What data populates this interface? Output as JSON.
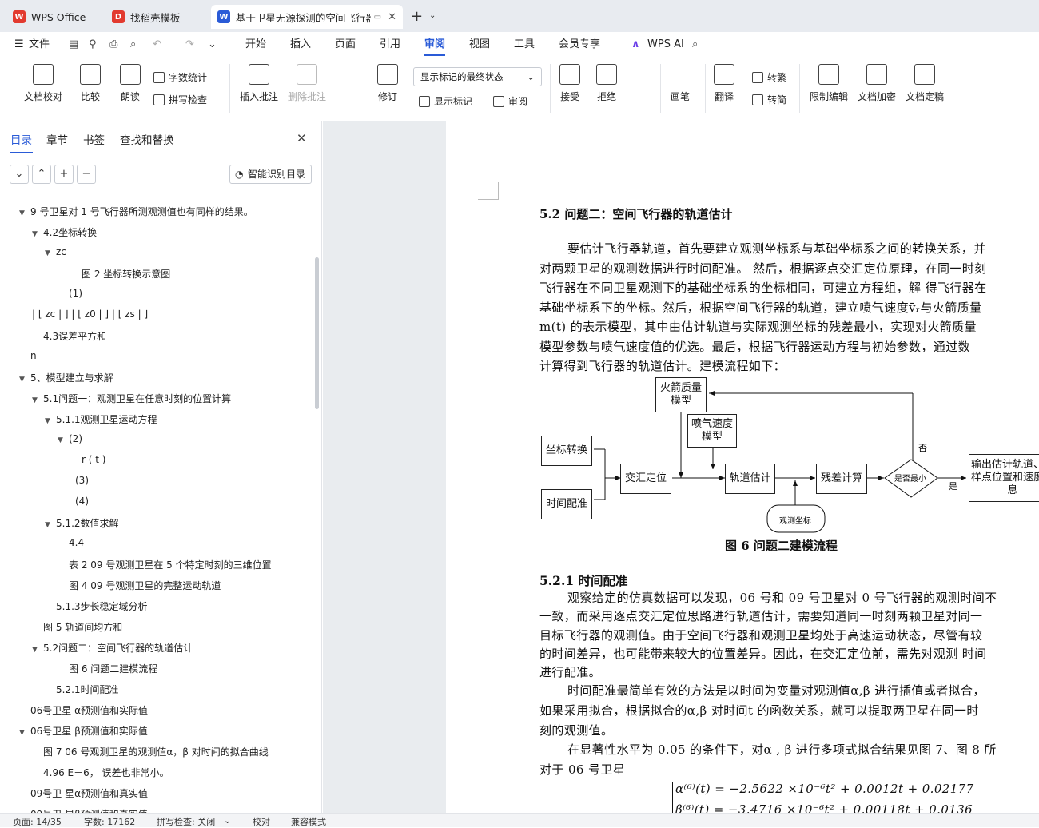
{
  "tabs": [
    {
      "label": "WPS Office",
      "icon": "wps-logo-icon",
      "color": "#e23a2f"
    },
    {
      "label": "找稻壳模板",
      "icon": "docer-icon",
      "color": "#e23a2f"
    },
    {
      "label": "基于卫星无源探测的空间飞行器",
      "icon": "writer-icon",
      "color": "#2a5bd7"
    }
  ],
  "menu": {
    "file": "文件",
    "items": [
      "开始",
      "插入",
      "页面",
      "引用",
      "审阅",
      "视图",
      "工具",
      "会员专享"
    ],
    "active": "审阅",
    "wps_ai": "WPS AI"
  },
  "ribbon": {
    "doc_proof": "文档校对",
    "compare": "比较",
    "read_aloud": "朗读",
    "word_count": "字数统计",
    "spell_check": "拼写检查",
    "insert_comment": "插入批注",
    "delete_comment": "删除批注",
    "revise": "修订",
    "markup_state": "显示标记的最终状态",
    "show_markup": "显示标记",
    "review_pane": "审阅",
    "accept": "接受",
    "reject": "拒绝",
    "ink": "画笔",
    "translate": "翻译",
    "to_traditional": "转繁",
    "to_simplified": "转简",
    "restrict_edit": "限制编辑",
    "encrypt": "文档加密",
    "finalize": "文档定稿"
  },
  "sidebar": {
    "tabs": [
      "目录",
      "章节",
      "书签",
      "查找和替换"
    ],
    "smart_toc": "智能识别目录",
    "toc": [
      {
        "label": "9 号卫星对 1 号飞行器所测观测值也有同样的结果。",
        "level": 0,
        "arrow": true
      },
      {
        "label": "4.2坐标转换",
        "level": 1,
        "arrow": true
      },
      {
        "label": "zc",
        "level": 2,
        "arrow": true
      },
      {
        "label": "图 2 坐标转换示意图",
        "level": 4,
        "arrow": false
      },
      {
        "label": "(1)",
        "level": 3,
        "arrow": false
      },
      {
        "label": "| ⌊ zc | ⌋ | ⌊ z0 | ⌋ | ⌊ zs | ⌋",
        "level": 1,
        "arrow": false,
        "shift": -14
      },
      {
        "label": "4.3误差平方和",
        "level": 1,
        "arrow": false
      },
      {
        "label": "n",
        "level": 0,
        "arrow": false
      },
      {
        "label": "5、模型建立与求解",
        "level": 0,
        "arrow": true
      },
      {
        "label": "5.1问题一：观测卫星在任意时刻的位置计算",
        "level": 1,
        "arrow": true
      },
      {
        "label": "5.1.1观测卫星运动方程",
        "level": 2,
        "arrow": true
      },
      {
        "label": "(2)",
        "level": 3,
        "arrow": true
      },
      {
        "label": "r ( t )",
        "level": 4,
        "arrow": false
      },
      {
        "label": "(3)",
        "level": 4,
        "arrow": false,
        "shift": -8
      },
      {
        "label": "(4)",
        "level": 4,
        "arrow": false,
        "shift": -8
      },
      {
        "label": "5.1.2数值求解",
        "level": 2,
        "arrow": true
      },
      {
        "label": "4.4",
        "level": 4,
        "arrow": false,
        "shift": -16
      },
      {
        "label": "表 2 09 号观测卫星在 5 个特定时刻的三维位置",
        "level": 4,
        "arrow": false,
        "shift": -16
      },
      {
        "label": "图 4 09 号观测卫星的完整运动轨道",
        "level": 4,
        "arrow": false,
        "shift": -16
      },
      {
        "label": "5.1.3步长稳定域分析",
        "level": 2,
        "arrow": false
      },
      {
        "label": "图 5 轨道间均方和",
        "level": 1,
        "arrow": false
      },
      {
        "label": "5.2问题二：空间飞行器的轨道估计",
        "level": 1,
        "arrow": true
      },
      {
        "label": "图 6 问题二建模流程",
        "level": 4,
        "arrow": false,
        "shift": -16
      },
      {
        "label": "5.2.1时间配准",
        "level": 2,
        "arrow": false
      },
      {
        "label": "06号卫星 α预测值和实际值",
        "level": 0,
        "arrow": false
      },
      {
        "label": "06号卫星 β预测值和实际值",
        "level": 0,
        "arrow": true
      },
      {
        "label": "图 7 06 号观测卫星的观测值α，β 对时间的拟合曲线",
        "level": 1,
        "arrow": false
      },
      {
        "label": "4.96 E－6， 误差也非常小。",
        "level": 1,
        "arrow": false
      },
      {
        "label": "09号卫 星α预测值和真实值",
        "level": 0,
        "arrow": false
      },
      {
        "label": "09号卫 星β预测值和真实值",
        "level": 0,
        "arrow": false
      }
    ]
  },
  "document": {
    "section_title": "5.2  问题二：空间飞行器的轨道估计",
    "para1": [
      "要估计飞行器轨道，首先要建立观测坐标系与基础坐标系之间的转换关系，并",
      "对两颗卫星的观测数据进行时间配准。 然后，根据逐点交汇定位原理，在同一时刻",
      "飞行器在不同卫星观测下的基础坐标系的坐标相同，可建立方程组，解    得飞行器在",
      "基础坐标系下的坐标。然后，根据空间飞行器的轨道，建立喷气速度v̄ᵣ与火箭质量",
      "m(t) 的表示模型，其中由估计轨道与实际观测坐标的残差最小，实现对火箭质量",
      "模型参数与喷气速度值的优选。最后，根据飞行器运动方程与初始参数，通过数",
      "计算得到飞行器的轨道估计。建模流程如下："
    ],
    "flow": {
      "rocket_mass": "火箭质量模型",
      "jet_speed": "喷气速度模型",
      "coord_transform": "坐标转换",
      "time_align": "时间配准",
      "intersect": "交汇定位",
      "orbit_est": "轨道估计",
      "residual": "残差计算",
      "is_min": "是否最小",
      "output": "输出估计轨道、采样点位置和速度信息",
      "obs_coord": "观测坐标",
      "yes": "是",
      "no": "否"
    },
    "figure_caption": "图 6    问题二建模流程",
    "subsection_title": "5.2.1 时间配准",
    "para2": [
      "观察给定的仿真数据可以发现，06 号和 09 号卫星对 0 号飞行器的观测时间不",
      "一致，而采用逐点交汇定位思路进行轨道估计，需要知道同一时刻两颗卫星对同一",
      "目标飞行器的观测值。由于空间飞行器和观测卫星均处于高速运动状态，尽管有较",
      "的时间差异，也可能带来较大的位置差异。因此，在交汇定位前，需先对观测 时间",
      "进行配准。"
    ],
    "para3": [
      "时间配准最简单有效的方法是以时间为变量对观测值α,β 进行插值或者拟合，",
      "如果采用拟合，根据拟合的α,β 对时间t 的函数关系，就可以提取两卫星在同一时",
      "刻的观测值。"
    ],
    "para4": [
      "在显著性水平为  0.05 的条件下，对α , β 进行多项式拟合结果见图  7、图  8 所",
      "对于  06 号卫星"
    ],
    "formula1": "α⁽⁶⁾(t) = −2.5622 ×10⁻⁶t² + 0.0012t + 0.02177",
    "formula2": "β⁽⁶⁾(t) = −3.4716 ×10⁻⁶t² + 0.00118t + 0.0136"
  },
  "status": {
    "page": "页面: 14/35",
    "words": "字数: 17162",
    "spell": "拼写检查: 关闭",
    "proof": "校对",
    "compat": "兼容模式"
  }
}
